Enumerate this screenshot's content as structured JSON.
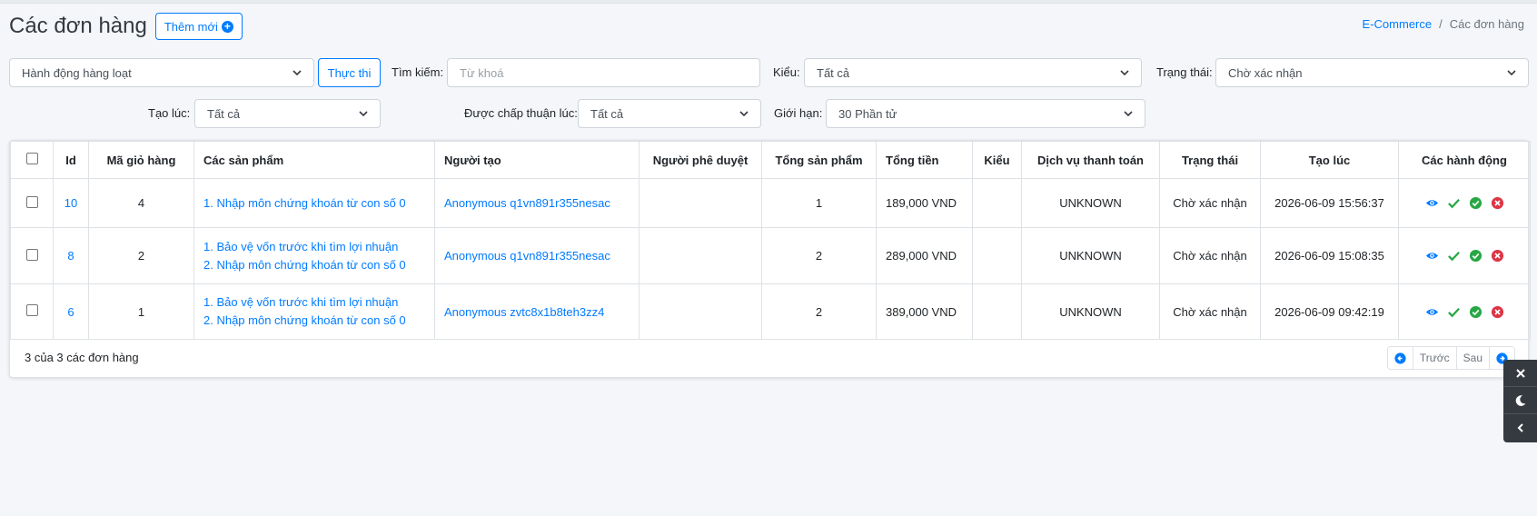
{
  "header": {
    "title": "Các đơn hàng",
    "add_button": "Thêm mới"
  },
  "breadcrumb": {
    "parent": "E-Commerce",
    "separator": "/",
    "current": "Các đơn hàng"
  },
  "filters": {
    "bulk_action": "Hành động hàng loạt",
    "execute_button": "Thực thi",
    "search_label": "Tìm kiếm:",
    "search_placeholder": "Từ khoá",
    "type_label": "Kiểu:",
    "type_value": "Tất cả",
    "status_label": "Trạng thái:",
    "status_value": "Chờ xác nhận",
    "created_label": "Tạo lúc:",
    "created_value": "Tất cả",
    "approved_label": "Được chấp thuận lúc:",
    "approved_value": "Tất cả",
    "limit_label": "Giới hạn:",
    "limit_value": "30 Phần tử"
  },
  "table": {
    "columns": [
      "Id",
      "Mã giỏ hàng",
      "Các sản phẩm",
      "Người tạo",
      "Người phê duyệt",
      "Tổng sản phẩm",
      "Tổng tiền",
      "Kiểu",
      "Dịch vụ thanh toán",
      "Trạng thái",
      "Tạo lúc",
      "Các hành động"
    ],
    "rows": [
      {
        "id": "10",
        "cart": "4",
        "products": [
          "1. Nhập môn chứng khoán từ con số 0"
        ],
        "creator": "Anonymous q1vn891r355nesac",
        "approver": "",
        "total_products": "1",
        "total": "189,000 VND",
        "type": "",
        "payment": "UNKNOWN",
        "status": "Chờ xác nhận",
        "created": "2026-06-09 15:56:37"
      },
      {
        "id": "8",
        "cart": "2",
        "products": [
          "1. Bảo vệ vốn trước khi tìm lợi nhuận",
          "2. Nhập môn chứng khoán từ con số 0"
        ],
        "creator": "Anonymous q1vn891r355nesac",
        "approver": "",
        "total_products": "2",
        "total": "289,000 VND",
        "type": "",
        "payment": "UNKNOWN",
        "status": "Chờ xác nhận",
        "created": "2026-06-09 15:08:35"
      },
      {
        "id": "6",
        "cart": "1",
        "products": [
          "1. Bảo vệ vốn trước khi tìm lợi nhuận",
          "2. Nhập môn chứng khoán từ con số 0"
        ],
        "creator": "Anonymous zvtc8x1b8teh3zz4",
        "approver": "",
        "total_products": "2",
        "total": "389,000 VND",
        "type": "",
        "payment": "UNKNOWN",
        "status": "Chờ xác nhận",
        "created": "2026-06-09 09:42:19"
      }
    ]
  },
  "footer": {
    "count_text": "3 của 3 các đơn hàng",
    "prev_label": "Trước",
    "next_label": "Sau"
  },
  "colors": {
    "primary": "#007bff",
    "success": "#28a745",
    "danger": "#dc3545",
    "sidebar_dark": "#343a40"
  },
  "icons": [
    "plus-circle-icon",
    "eye-icon",
    "check-icon",
    "check-circle-icon",
    "times-circle-icon",
    "arrow-left-circle-icon",
    "arrow-right-circle-icon",
    "close-icon",
    "moon-icon",
    "chevron-left-icon"
  ]
}
